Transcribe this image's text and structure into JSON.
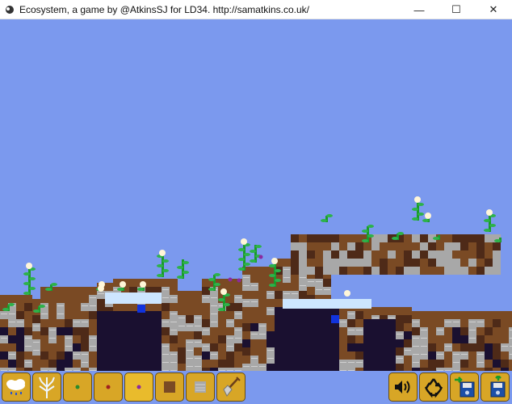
{
  "window": {
    "title": "Ecosystem, a game by @AtkinsSJ for LD34. http://samatkins.co.uk/",
    "controls": {
      "minimize": "—",
      "maximize": "☐",
      "close": "✕"
    }
  },
  "palette": {
    "sky": "#7b99ee",
    "dirt": "#7a4a24",
    "dirt_dark": "#4e2a18",
    "stone": "#a8a8a8",
    "stone_light": "#d0d0d0",
    "deep": "#1a1030",
    "water": "#cde6ff",
    "water_deep": "#1133dd",
    "grass": "#1a9a2a",
    "toolbar": "#d8a626"
  },
  "toolbar": {
    "left_tools": [
      {
        "name": "rain-cloud-tool",
        "icon": "rain-cloud-icon"
      },
      {
        "name": "tree-seed-tool",
        "icon": "tree-icon"
      },
      {
        "name": "green-seed-tool",
        "icon": "green-seed-icon",
        "color": "#2c8a2c"
      },
      {
        "name": "red-seed-tool",
        "icon": "red-seed-icon",
        "color": "#a02020"
      },
      {
        "name": "purple-seed-tool",
        "icon": "purple-seed-icon",
        "color": "#8a2aa0"
      },
      {
        "name": "dirt-block-tool",
        "icon": "dirt-block-icon",
        "color": "#7a4a24"
      },
      {
        "name": "stone-block-tool",
        "icon": "stone-block-icon",
        "color": "#a8a8a8"
      },
      {
        "name": "shovel-tool",
        "icon": "shovel-icon"
      }
    ],
    "right_tools": [
      {
        "name": "sound-toggle",
        "icon": "speaker-icon"
      },
      {
        "name": "reset-button",
        "icon": "recycle-icon"
      },
      {
        "name": "save-button",
        "icon": "save-icon"
      },
      {
        "name": "load-button",
        "icon": "load-icon"
      }
    ]
  }
}
